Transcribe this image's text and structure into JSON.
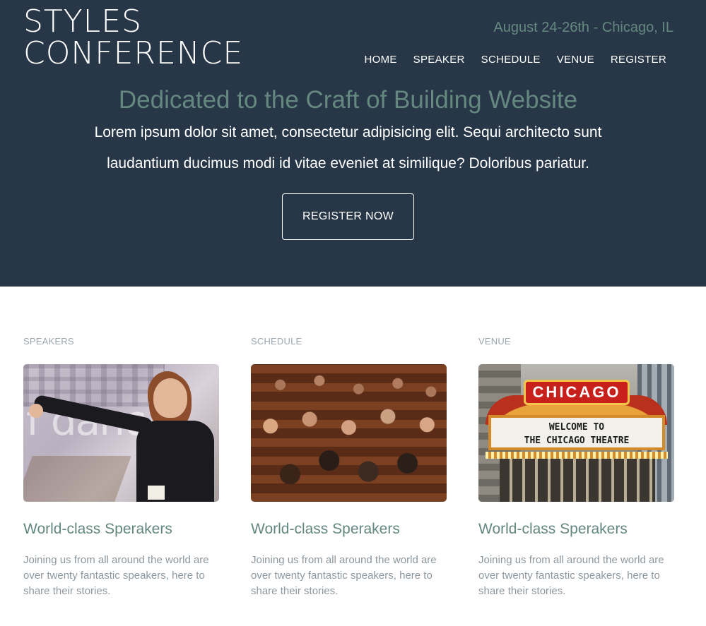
{
  "header": {
    "logo_line1": "STYLES",
    "logo_line2": "CONFERENCE",
    "dates": "August 24-26th - Chicago, IL",
    "nav": [
      "HOME",
      "SPEAKER",
      "SCHEDULE",
      "VENUE",
      "REGISTER"
    ]
  },
  "hero": {
    "headline": "Dedicated to the Craft of Building Website",
    "lead": "Lorem ipsum dolor sit amet, consectetur adipisicing elit. Sequi architecto sunt laudantium ducimus modi id vitae eveniet at similique? Doloribus pariatur.",
    "cta": "REGISTER NOW"
  },
  "features": [
    {
      "kicker": "SPEAKERS",
      "photo": "speaker-photo",
      "title": "World-class Sperakers",
      "desc": "Joining us from all around the world are over twenty fantastic speakers, here to share their stories."
    },
    {
      "kicker": "SCHEDULE",
      "photo": "audience-photo",
      "title": "World-class Sperakers",
      "desc": "Joining us from all around the world are over twenty fantastic speakers, here to share their stories."
    },
    {
      "kicker": "VENUE",
      "photo": "theatre-photo",
      "title": "World-class Sperakers",
      "desc": "Joining us from all around the world are over twenty fantastic speakers, here to share their stories.",
      "photo_text": {
        "sign": "CHICAGO",
        "marquee_line1": "WELCOME TO",
        "marquee_line2": "THE CHICAGO THEATRE"
      }
    }
  ],
  "colors": {
    "hero_bg": "#283747",
    "accent": "#648880",
    "muted_text": "#8d979e",
    "kicker": "#9aa6ae"
  }
}
